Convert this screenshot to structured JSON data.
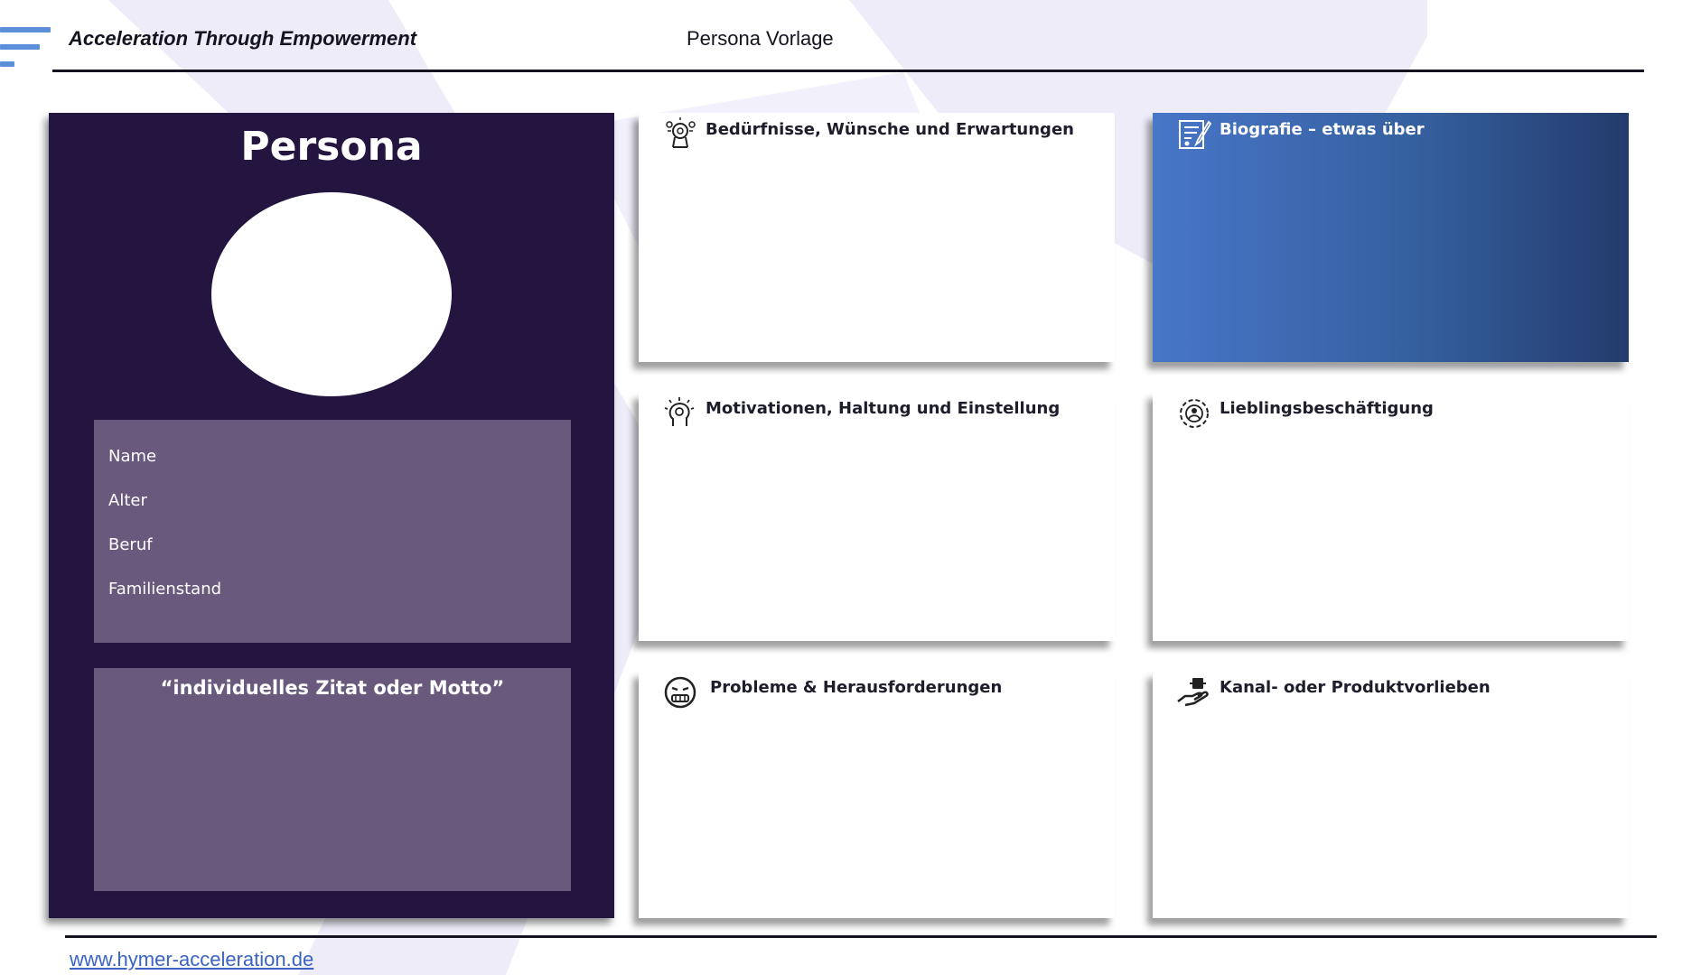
{
  "header": {
    "title": "Acceleration Through Empowerment",
    "subtitle": "Persona Vorlage"
  },
  "persona_card": {
    "title": "Persona",
    "fields": [
      "Name",
      "Alter",
      "Beruf",
      "Familienstand"
    ],
    "quote": "“individuelles Zitat oder Motto”"
  },
  "panels": [
    {
      "icon": "brain-gears-icon",
      "title": "Bedürfnisse, Wünsche und Erwartungen"
    },
    {
      "icon": "biography-notepad-icon",
      "title": "Biografie – etwas über"
    },
    {
      "icon": "motivation-head-icon",
      "title": "Motivationen, Haltung und Einstellung"
    },
    {
      "icon": "favorite-activity-icon",
      "title": "Lieblingsbeschäftigung"
    },
    {
      "icon": "stressed-face-icon",
      "title": "Probleme & Herausforderungen"
    },
    {
      "icon": "hand-product-icon",
      "title": "Kanal- oder Produktvorlieben"
    }
  ],
  "footer": {
    "link": "www.hymer-acceleration.de"
  },
  "colors": {
    "persona_background": "#23153f",
    "info_box": "#695a7d",
    "biografie_gradient_start": "#4876c8",
    "biografie_gradient_end": "#233b6c",
    "accent_lines": "#5b8fd9",
    "background_swoosh": "#eeecf8",
    "link": "#3a63c4"
  }
}
